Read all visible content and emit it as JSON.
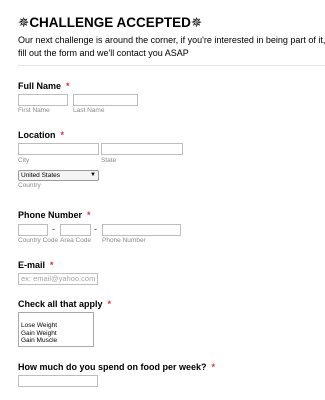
{
  "form": {
    "title_icon": "✵",
    "title": "CHALLENGE ACCEPTED",
    "subtitle": "Our next challenge is around the corner, if you're interested in being part of it, fill out the form and we'll contact you ASAP"
  },
  "required_mark": "*",
  "full_name": {
    "label": "Full Name",
    "first_sublabel": "First Name",
    "last_sublabel": "Last Name",
    "first_value": "",
    "last_value": ""
  },
  "location": {
    "label": "Location",
    "city_sublabel": "City",
    "state_sublabel": "State",
    "country_selected": "United States",
    "country_sublabel": "Country"
  },
  "phone": {
    "label": "Phone Number",
    "separator": "-",
    "country_code_sublabel": "Country Code",
    "area_code_sublabel": "Area Code",
    "phone_sublabel": "Phone Number"
  },
  "email": {
    "label": "E-mail",
    "placeholder": "ex: email@yahoo.com"
  },
  "checks": {
    "label": "Check all that apply",
    "options": [
      "Lose Weight",
      "Gain Weight",
      "Gain Muscle"
    ]
  },
  "food": {
    "label": "How much do you spend on food per week?"
  }
}
